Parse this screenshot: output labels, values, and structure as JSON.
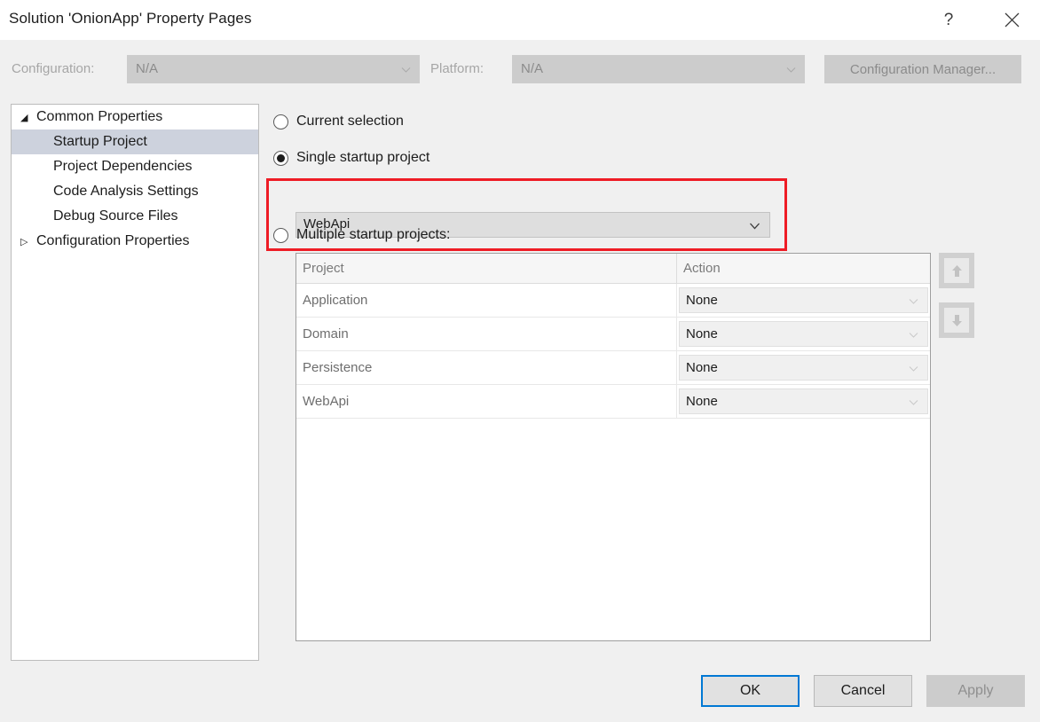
{
  "window": {
    "title": "Solution 'OnionApp' Property Pages",
    "help_icon": "question-mark-icon",
    "close_icon": "close-icon"
  },
  "config_bar": {
    "configuration_label": "Configuration:",
    "configuration_value": "N/A",
    "platform_label": "Platform:",
    "platform_value": "N/A",
    "configuration_manager_label": "Configuration Manager..."
  },
  "tree": {
    "items": [
      {
        "label": "Common Properties",
        "level": 0,
        "twisty": "◢",
        "selected": false
      },
      {
        "label": "Startup Project",
        "level": 1,
        "twisty": "",
        "selected": true
      },
      {
        "label": "Project Dependencies",
        "level": 1,
        "twisty": "",
        "selected": false
      },
      {
        "label": "Code Analysis Settings",
        "level": 1,
        "twisty": "",
        "selected": false
      },
      {
        "label": "Debug Source Files",
        "level": 1,
        "twisty": "",
        "selected": false
      },
      {
        "label": "Configuration Properties",
        "level": 0,
        "twisty": "▷",
        "selected": false
      }
    ]
  },
  "startup": {
    "current_selection_label": "Current selection",
    "single_startup_label": "Single startup project",
    "single_startup_value": "WebApi",
    "multiple_startup_label": "Multiple startup projects:",
    "selected_option": "single_startup_project",
    "highlight_color": "#ee1c25"
  },
  "grid": {
    "columns": [
      "Project",
      "Action"
    ],
    "rows": [
      {
        "project": "Application",
        "action": "None"
      },
      {
        "project": "Domain",
        "action": "None"
      },
      {
        "project": "Persistence",
        "action": "None"
      },
      {
        "project": "WebApi",
        "action": "None"
      }
    ]
  },
  "order_buttons": {
    "move_up_icon": "arrow-up-icon",
    "move_down_icon": "arrow-down-icon"
  },
  "footer": {
    "ok_label": "OK",
    "cancel_label": "Cancel",
    "apply_label": "Apply",
    "focus_color": "#0078d4"
  }
}
